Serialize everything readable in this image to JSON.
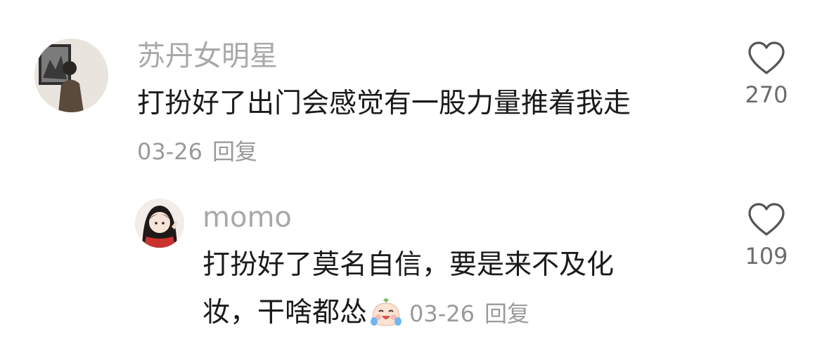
{
  "comments": [
    {
      "username": "苏丹女明星",
      "text": "打扮好了出门会感觉有一股力量推着我走",
      "date": "03-26",
      "reply_label": "回复",
      "like_count": "270",
      "like_icon": "heart-outline-icon"
    },
    {
      "username": "momo",
      "text_line1": "打扮好了莫名自信，要是来不及化",
      "text_line2": "妆，干啥都怂",
      "emoji": "crying-laughing-face-emoji",
      "date": "03-26",
      "reply_label": "回复",
      "like_count": "109",
      "like_icon": "heart-outline-icon"
    }
  ]
}
